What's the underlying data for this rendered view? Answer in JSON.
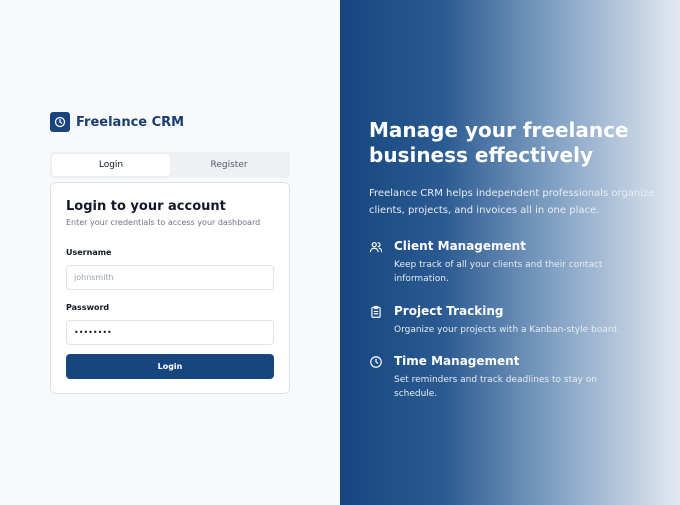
{
  "brand": {
    "name": "Freelance CRM",
    "icon": "clock-icon"
  },
  "tabs": [
    {
      "label": "Login",
      "active": true
    },
    {
      "label": "Register",
      "active": false
    }
  ],
  "login": {
    "title": "Login to your account",
    "subtitle": "Enter your credentials to access your dashboard",
    "username_label": "Username",
    "username_placeholder": "johnsmith",
    "username_value": "",
    "password_label": "Password",
    "password_value": "password",
    "button_label": "Login"
  },
  "hero": {
    "headline": "Manage your freelance business effectively",
    "description": "Freelance CRM helps independent professionals organize clients, projects, and invoices all in one place.",
    "features": [
      {
        "icon": "users-icon",
        "title": "Client Management",
        "description": "Keep track of all your clients and their contact information."
      },
      {
        "icon": "clipboard-icon",
        "title": "Project Tracking",
        "description": "Organize your projects with a Kanban-style board."
      },
      {
        "icon": "clock-icon",
        "title": "Time Management",
        "description": "Set reminders and track deadlines to stay on schedule."
      }
    ]
  },
  "colors": {
    "brand": "#1a4480",
    "button": "#17467f",
    "panel_start": "#16467f",
    "panel_end": "#e3e9f1"
  }
}
